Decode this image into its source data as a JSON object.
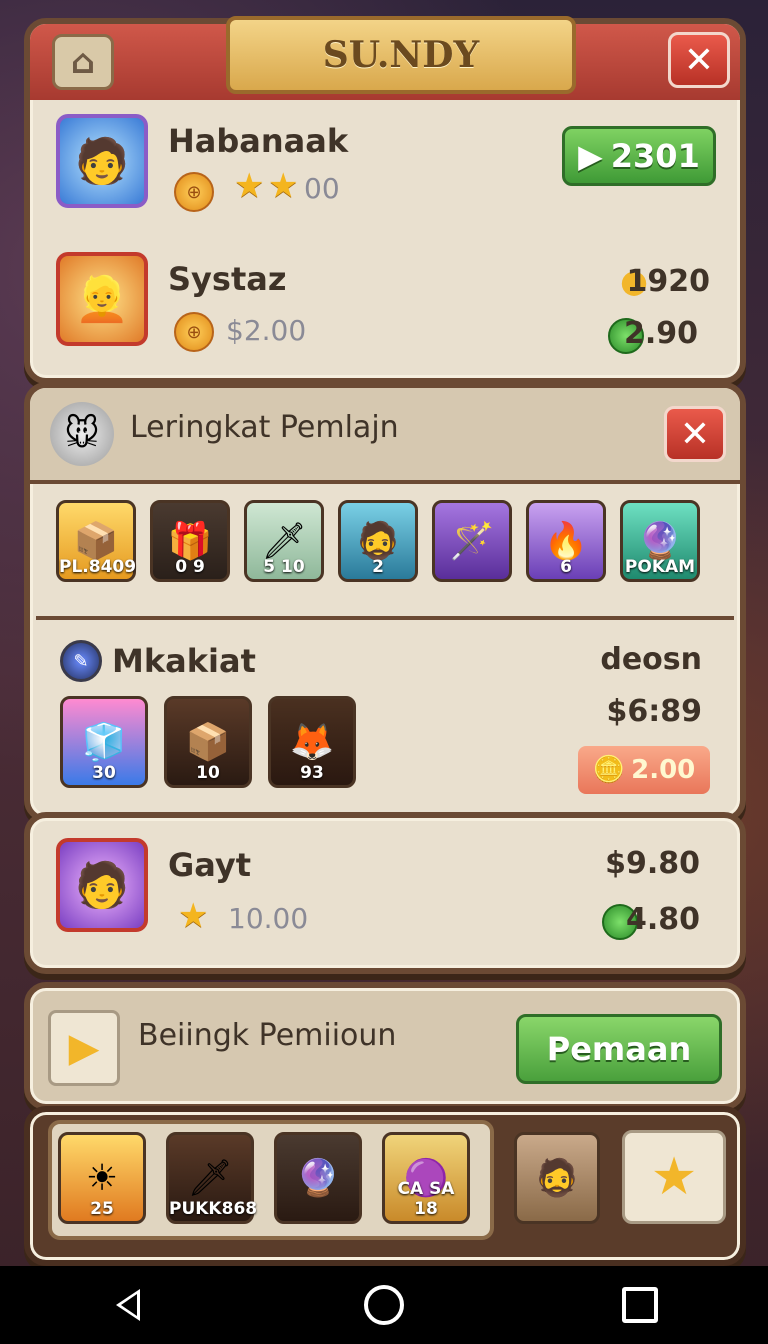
{
  "header": {
    "title": "SU.NDY",
    "close_glyph": "✕",
    "home_glyph": "⌂"
  },
  "players": [
    {
      "name": "Habanaak",
      "stat": "00",
      "play_label": "2301",
      "play_glyph": "▶"
    },
    {
      "name": "Systaz",
      "amount": "$2.00",
      "score": "1920",
      "gems": "2.90"
    }
  ],
  "section": {
    "title": "Leringkat Pemlajn",
    "items": [
      {
        "label": "PL.8409"
      },
      {
        "label": "0 9"
      },
      {
        "label": "5 10"
      },
      {
        "label": "2"
      },
      {
        "label": ""
      },
      {
        "label": "6"
      },
      {
        "label": "POKAM"
      }
    ]
  },
  "market": {
    "name": "Mkakiat",
    "right_label": "deosn",
    "price": "$6:89",
    "button_value": "2.00",
    "items": [
      {
        "label": "30"
      },
      {
        "label": "10"
      },
      {
        "label": "93"
      }
    ]
  },
  "gayt": {
    "name": "Gayt",
    "stat": "10.00",
    "price": "$9.80",
    "gems": "4.80"
  },
  "cta": {
    "text": "Beiingk Pemiioun",
    "button_label": "Pemaan"
  },
  "inventory": {
    "items": [
      {
        "label": "25"
      },
      {
        "label": "PUKK868"
      },
      {
        "label": ""
      },
      {
        "label": "CA SA 18"
      }
    ]
  },
  "colors": {
    "accent_green": "#4aa03c",
    "accent_red": "#b83126",
    "frame": "#6b4a34",
    "parchment": "#e9e0cf"
  }
}
